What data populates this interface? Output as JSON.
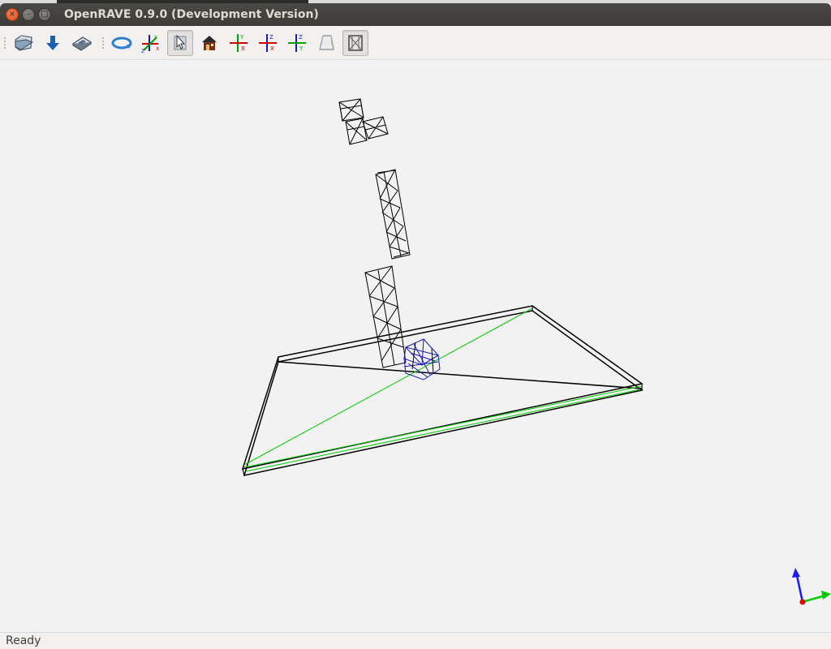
{
  "window": {
    "title": "OpenRAVE 0.9.0 (Development Version)",
    "buttons": [
      {
        "name": "close",
        "glyph": "×"
      },
      {
        "name": "minimize",
        "glyph": "–"
      },
      {
        "name": "maximize",
        "glyph": "□"
      }
    ]
  },
  "toolbar": {
    "groups": [
      [
        {
          "icon": "open-file-icon"
        },
        {
          "icon": "download-arrow-icon"
        },
        {
          "icon": "save-icon"
        }
      ],
      [
        {
          "icon": "rotate-view-icon"
        },
        {
          "icon": "axes-zxy-icon"
        },
        {
          "icon": "select-pointer-icon",
          "pressed": true
        },
        {
          "icon": "home-icon"
        },
        {
          "icon": "view-xy-icon",
          "axes": [
            "Y",
            "X"
          ]
        },
        {
          "icon": "view-zx-icon",
          "axes": [
            "Z",
            "X"
          ]
        },
        {
          "icon": "view-zy-icon",
          "axes": [
            "Z",
            "Y"
          ]
        },
        {
          "icon": "perspective-box-icon"
        },
        {
          "icon": "wireframe-toggle-icon",
          "pressed": true
        }
      ]
    ]
  },
  "status": {
    "text": "Ready"
  },
  "colors": {
    "viewer_background": "#f2f2f2",
    "wire_black": "#000000",
    "wire_green": "#00cc00",
    "wire_blue": "#1a1ab0",
    "axis_x": "#00cc00",
    "axis_z": "#1a1aff",
    "axis_origin": "#e00000"
  }
}
